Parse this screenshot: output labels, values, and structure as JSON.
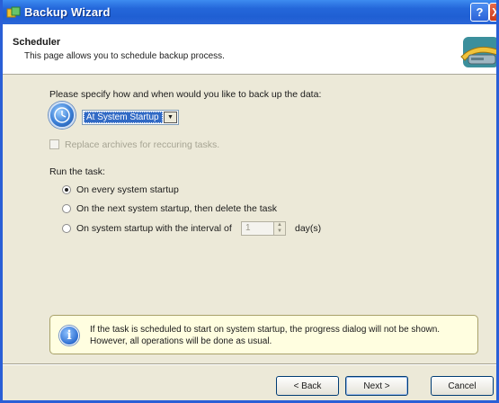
{
  "window": {
    "title": "Backup Wizard",
    "help_glyph": "?",
    "close_glyph": "X"
  },
  "header": {
    "title": "Scheduler",
    "subtitle": "This page allows you to schedule backup process."
  },
  "schedule": {
    "prompt": "Please specify how and when would you like to back up the data:",
    "selected": "At System Startup",
    "checkbox_label": "Replace archives for reccuring tasks.",
    "checkbox_checked": false,
    "checkbox_enabled": false
  },
  "run": {
    "label": "Run the task:",
    "options": [
      {
        "label": "On every system startup",
        "checked": true
      },
      {
        "label": "On the next system startup, then delete the task",
        "checked": false
      },
      {
        "label": "On system startup with the interval of",
        "checked": false
      }
    ],
    "interval_value": "1",
    "interval_unit": "day(s)"
  },
  "info": {
    "icon": "info-icon",
    "line1": "If the task is scheduled to start on system startup, the progress dialog will not be shown.",
    "line2": "However, all operations will be done as usual."
  },
  "buttons": {
    "back": "< Back",
    "next": "Next >",
    "cancel": "Cancel"
  },
  "colors": {
    "titlebar": "#2467da",
    "selection": "#316ac5",
    "info_bg": "#fffee0"
  }
}
